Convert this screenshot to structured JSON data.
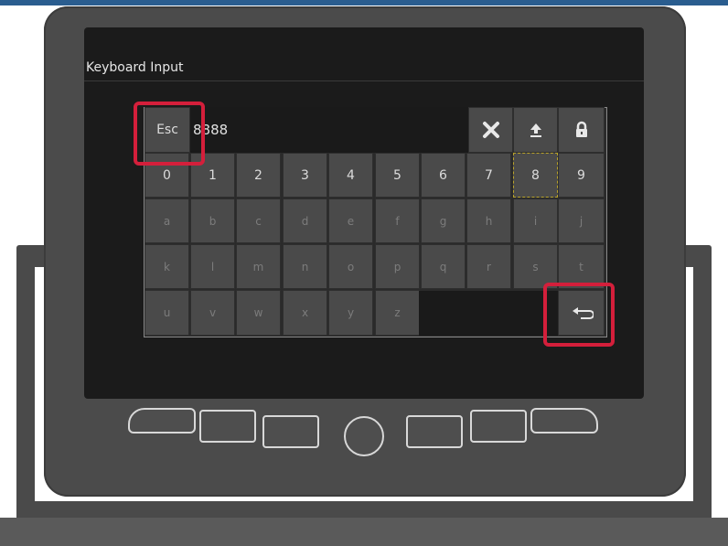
{
  "window": {
    "title": "Keyboard Input"
  },
  "input": {
    "value": "8888"
  },
  "keys": {
    "esc": "Esc",
    "digits": [
      "0",
      "1",
      "2",
      "3",
      "4",
      "5",
      "6",
      "7",
      "8",
      "9"
    ],
    "row_a": [
      "a",
      "b",
      "c",
      "d",
      "e",
      "f",
      "g",
      "h",
      "i",
      "j"
    ],
    "row_k": [
      "k",
      "l",
      "m",
      "n",
      "o",
      "p",
      "q",
      "r",
      "s",
      "t"
    ],
    "row_u": [
      "u",
      "v",
      "w",
      "x",
      "y",
      "z"
    ],
    "selected_key": "8"
  },
  "icons": {
    "clear": "close-icon",
    "shift": "upload-arrow-icon",
    "lock": "lock-icon",
    "enter": "return-arrow-icon"
  },
  "colors": {
    "highlight": "#d41f3b",
    "focus": "#b8a22a"
  }
}
